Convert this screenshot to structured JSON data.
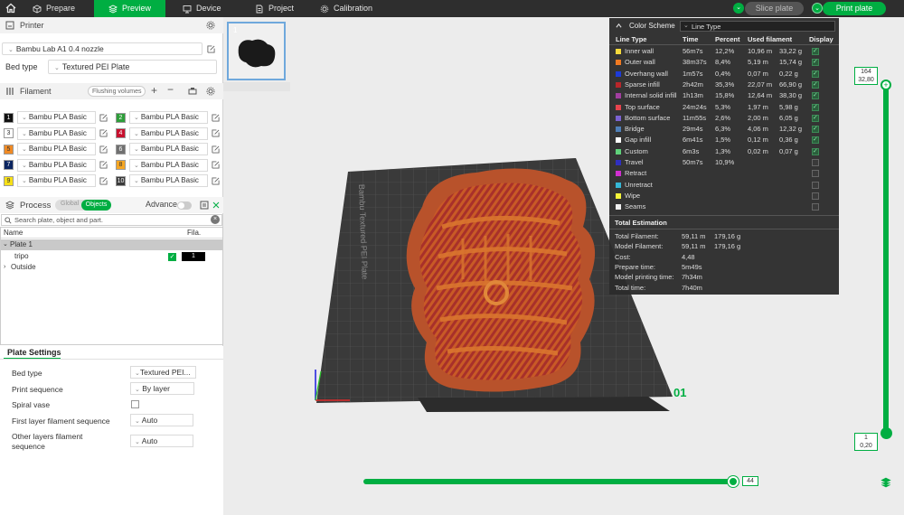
{
  "topbar": {
    "tabs": [
      {
        "label": "Prepare",
        "icon": "cube-icon"
      },
      {
        "label": "Preview",
        "icon": "layers-icon",
        "active": true
      },
      {
        "label": "Device",
        "icon": "device-icon"
      },
      {
        "label": "Project",
        "icon": "document-icon"
      },
      {
        "label": "Calibration",
        "icon": "gear-icon"
      }
    ],
    "slice_label": "Slice plate",
    "print_label": "Print plate",
    "accent": "#00ae42"
  },
  "printer": {
    "title": "Printer",
    "model": "Bambu Lab A1 0.4 nozzle",
    "bed_label": "Bed type",
    "bed_value": "Textured PEI Plate"
  },
  "filament": {
    "title": "Filament",
    "flushing_label": "Flushing volumes",
    "items": [
      {
        "num": "1",
        "name": "Bambu PLA Basic",
        "color": "#111111",
        "text": "#ffffff"
      },
      {
        "num": "2",
        "name": "Bambu PLA Basic",
        "color": "#2e9e3a",
        "text": "#ffffff"
      },
      {
        "num": "3",
        "name": "Bambu PLA Basic",
        "color": "#ffffff",
        "text": "#333333"
      },
      {
        "num": "4",
        "name": "Bambu PLA Basic",
        "color": "#c8102e",
        "text": "#ffffff"
      },
      {
        "num": "5",
        "name": "Bambu PLA Basic",
        "color": "#f08a24",
        "text": "#333333"
      },
      {
        "num": "6",
        "name": "Bambu PLA Basic",
        "color": "#707070",
        "text": "#ffffff"
      },
      {
        "num": "7",
        "name": "Bambu PLA Basic",
        "color": "#0b2560",
        "text": "#ffffff"
      },
      {
        "num": "8",
        "name": "Bambu PLA Basic",
        "color": "#f5a623",
        "text": "#333333"
      },
      {
        "num": "9",
        "name": "Bambu PLA Basic",
        "color": "#f7e017",
        "text": "#333333"
      },
      {
        "num": "10",
        "name": "Bambu PLA Basic",
        "color": "#3a3a3a",
        "text": "#ffffff"
      }
    ]
  },
  "process": {
    "title": "Process",
    "global_label": "Global",
    "objects_label": "Objects",
    "advance_label": "Advance",
    "search_placeholder": "Search plate, object and part.",
    "col_name": "Name",
    "col_fila": "Fila.",
    "plate_label": "Plate 1",
    "object_label": "tripo",
    "object_fila": "1",
    "outside_label": "Outside"
  },
  "plate_settings": {
    "title": "Plate Settings",
    "rows": [
      {
        "label": "Bed type",
        "value": "Textured PEI..."
      },
      {
        "label": "Print sequence",
        "value": "By layer"
      },
      {
        "label": "Spiral vase",
        "value": ""
      },
      {
        "label": "First layer filament sequence",
        "value": "Auto"
      },
      {
        "label": "Other layers filament sequence",
        "value": "Auto"
      }
    ]
  },
  "viewport": {
    "thumb_index": "1",
    "bed_brand": "Bambu Textured PEI Plate",
    "plate_number": "01",
    "layer_top": "164",
    "layer_top_height": "32,80",
    "layer_bottom": "1",
    "layer_bottom_height": "0,20",
    "horizontal_value": "44"
  },
  "legend": {
    "title": "Color Scheme",
    "scheme": "Line Type",
    "headers": {
      "type": "Line Type",
      "time": "Time",
      "percent": "Percent",
      "used": "Used filament",
      "display": "Display"
    },
    "rows": [
      {
        "name": "Inner wall",
        "color": "#f5d93c",
        "time": "56m7s",
        "percent": "12,2%",
        "len": "10,96 m",
        "weight": "33,22 g",
        "on": true
      },
      {
        "name": "Outer wall",
        "color": "#f07a22",
        "time": "38m37s",
        "percent": "8,4%",
        "len": "5,19 m",
        "weight": "15,74 g",
        "on": true
      },
      {
        "name": "Overhang wall",
        "color": "#1d3bd8",
        "time": "1m57s",
        "percent": "0,4%",
        "len": "0,07 m",
        "weight": "0,22 g",
        "on": true
      },
      {
        "name": "Sparse infill",
        "color": "#b8262a",
        "time": "2h42m",
        "percent": "35,3%",
        "len": "22,07 m",
        "weight": "66,90 g",
        "on": true
      },
      {
        "name": "Internal solid infill",
        "color": "#a23ea0",
        "time": "1h13m",
        "percent": "15,8%",
        "len": "12,64 m",
        "weight": "38,30 g",
        "on": true
      },
      {
        "name": "Top surface",
        "color": "#e6444e",
        "time": "24m24s",
        "percent": "5,3%",
        "len": "1,97 m",
        "weight": "5,98 g",
        "on": true
      },
      {
        "name": "Bottom surface",
        "color": "#7b62d1",
        "time": "11m55s",
        "percent": "2,6%",
        "len": "2,00 m",
        "weight": "6,05 g",
        "on": true
      },
      {
        "name": "Bridge",
        "color": "#4f7fb8",
        "time": "29m4s",
        "percent": "6,3%",
        "len": "4,06 m",
        "weight": "12,32 g",
        "on": true
      },
      {
        "name": "Gap infill",
        "color": "#ffffff",
        "time": "6m41s",
        "percent": "1,5%",
        "len": "0,12 m",
        "weight": "0,36 g",
        "on": true
      },
      {
        "name": "Custom",
        "color": "#5fd17a",
        "time": "6m3s",
        "percent": "1,3%",
        "len": "0,02 m",
        "weight": "0,07 g",
        "on": true
      },
      {
        "name": "Travel",
        "color": "#2f2fc0",
        "time": "50m7s",
        "percent": "10,9%",
        "len": "",
        "weight": "",
        "on": false
      },
      {
        "name": "Retract",
        "color": "#d12fd1",
        "time": "",
        "percent": "",
        "len": "",
        "weight": "",
        "on": false
      },
      {
        "name": "Unretract",
        "color": "#35b7d6",
        "time": "",
        "percent": "",
        "len": "",
        "weight": "",
        "on": false
      },
      {
        "name": "Wipe",
        "color": "#f5f53a",
        "time": "",
        "percent": "",
        "len": "",
        "weight": "",
        "on": false
      },
      {
        "name": "Seams",
        "color": "#f0f0f0",
        "time": "",
        "percent": "",
        "len": "",
        "weight": "",
        "on": false
      }
    ],
    "total_title": "Total Estimation",
    "totals": [
      {
        "label": "Total Filament:",
        "v1": "59,11 m",
        "v2": "179,16 g"
      },
      {
        "label": "Model Filament:",
        "v1": "59,11 m",
        "v2": "179,16 g"
      },
      {
        "label": "Cost:",
        "v1": "4,48",
        "v2": ""
      },
      {
        "label": "Prepare time:",
        "v1": "5m49s",
        "v2": ""
      },
      {
        "label": "Model printing time:",
        "v1": "7h34m",
        "v2": ""
      },
      {
        "label": "Total time:",
        "v1": "7h40m",
        "v2": ""
      }
    ]
  }
}
